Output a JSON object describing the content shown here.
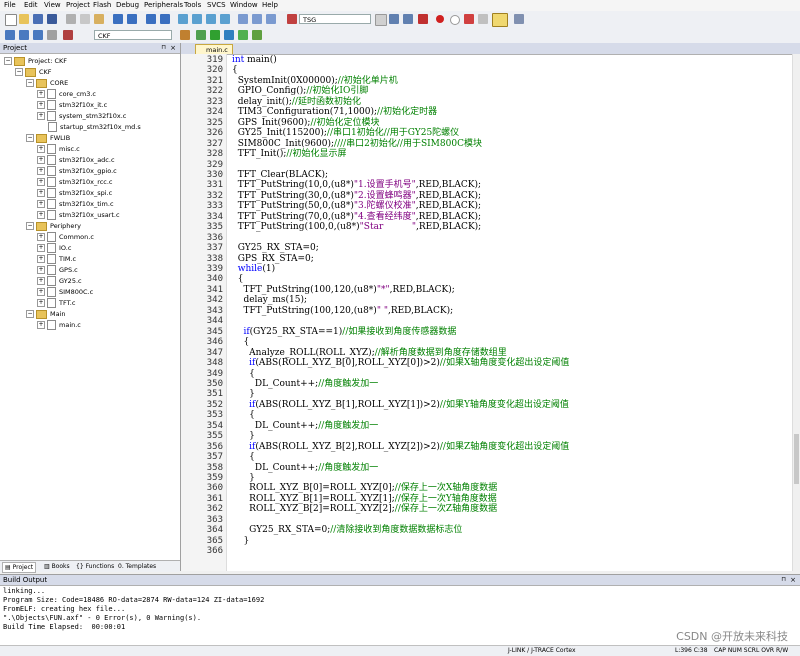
{
  "menu": [
    "File",
    "Edit",
    "View",
    "Project",
    "Flash",
    "Debug",
    "Peripherals",
    "Tools",
    "SVCS",
    "Window",
    "Help"
  ],
  "toolbar": {
    "target_combo": "TSG",
    "project_combo": "CKF"
  },
  "project_pane": {
    "title": "Project",
    "root": "Project: CKF",
    "target": "CKF",
    "groups": [
      {
        "name": "CORE",
        "files": [
          "core_cm3.c",
          "stm32f10x_it.c",
          "system_stm32f10x.c",
          "startup_stm32f10x_md.s"
        ]
      },
      {
        "name": "FWLIB",
        "files": [
          "misc.c",
          "stm32f10x_adc.c",
          "stm32f10x_gpio.c",
          "stm32f10x_rcc.c",
          "stm32f10x_spi.c",
          "stm32f10x_tim.c",
          "stm32f10x_usart.c"
        ]
      },
      {
        "name": "Periphery",
        "files": [
          "Common.c",
          "IO.c",
          "TIM.c",
          "GPS.c",
          "GY25.c",
          "SIM800C.c",
          "TFT.c"
        ]
      },
      {
        "name": "Main",
        "files": [
          "main.c"
        ]
      }
    ],
    "tabs": [
      "Project",
      "Books",
      "Functions",
      "Templates"
    ]
  },
  "editor": {
    "tab": "main.c",
    "lines": [
      {
        "n": "319",
        "t": "int main()"
      },
      {
        "n": "320",
        "t": "{"
      },
      {
        "n": "321",
        "t": "  SystemInit(0X00000);//初始化单片机"
      },
      {
        "n": "322",
        "t": "  GPIO_Config();//初始化IO引脚"
      },
      {
        "n": "323",
        "t": "  delay_init();//延时函数初始化"
      },
      {
        "n": "324",
        "t": "  TIM3_Configuration(71,1000);//初始化定时器"
      },
      {
        "n": "325",
        "t": "  GPS_Init(9600);//初始化定位模块"
      },
      {
        "n": "326",
        "t": "  GY25_Init(115200);//串口1初始化//用于GY25陀螺仪"
      },
      {
        "n": "327",
        "t": "  SIM800C_Init(9600);////串口2初始化//用于SIM800C模块"
      },
      {
        "n": "328",
        "t": "  TFT_Init();//初始化显示屏"
      },
      {
        "n": "329",
        "t": ""
      },
      {
        "n": "330",
        "t": "  TFT_Clear(BLACK);"
      },
      {
        "n": "331",
        "t": "  TFT_PutString(10,0,(u8*)\"1.设置手机号\",RED,BLACK);"
      },
      {
        "n": "332",
        "t": "  TFT_PutString(30,0,(u8*)\"2.设置蜂鸣器\",RED,BLACK);"
      },
      {
        "n": "333",
        "t": "  TFT_PutString(50,0,(u8*)\"3.陀螺仪校准\",RED,BLACK);"
      },
      {
        "n": "334",
        "t": "  TFT_PutString(70,0,(u8*)\"4.查看经纬度\",RED,BLACK);"
      },
      {
        "n": "335",
        "t": "  TFT_PutString(100,0,(u8*)\"Star          \",RED,BLACK);"
      },
      {
        "n": "336",
        "t": ""
      },
      {
        "n": "337",
        "t": "  GY25_RX_STA=0;"
      },
      {
        "n": "338",
        "t": "  GPS_RX_STA=0;"
      },
      {
        "n": "339",
        "t": "  while(1)"
      },
      {
        "n": "340",
        "t": "  {"
      },
      {
        "n": "341",
        "t": "    TFT_PutString(100,120,(u8*)\"*\",RED,BLACK);"
      },
      {
        "n": "342",
        "t": "    delay_ms(15);"
      },
      {
        "n": "343",
        "t": "    TFT_PutString(100,120,(u8*)\" \",RED,BLACK);"
      },
      {
        "n": "344",
        "t": ""
      },
      {
        "n": "345",
        "t": "    if(GY25_RX_STA==1)//如果接收到角度传感器数据"
      },
      {
        "n": "346",
        "t": "    {"
      },
      {
        "n": "347",
        "t": "      Analyze_ROLL(ROLL_XYZ);//解析角度数据到角度存储数组里"
      },
      {
        "n": "348",
        "t": "      if(ABS(ROLL_XYZ_B[0],ROLL_XYZ[0])>2)//如果X轴角度变化超出设定阈值"
      },
      {
        "n": "349",
        "t": "      {"
      },
      {
        "n": "350",
        "t": "        DL_Count++;//角度触发加一"
      },
      {
        "n": "351",
        "t": "      }"
      },
      {
        "n": "352",
        "t": "      if(ABS(ROLL_XYZ_B[1],ROLL_XYZ[1])>2)//如果Y轴角度变化超出设定阈值"
      },
      {
        "n": "353",
        "t": "      {"
      },
      {
        "n": "354",
        "t": "        DL_Count++;//角度触发加一"
      },
      {
        "n": "355",
        "t": "      }"
      },
      {
        "n": "356",
        "t": "      if(ABS(ROLL_XYZ_B[2],ROLL_XYZ[2])>2)//如果Z轴角度变化超出设定阈值"
      },
      {
        "n": "357",
        "t": "      {"
      },
      {
        "n": "358",
        "t": "        DL_Count++;//角度触发加一"
      },
      {
        "n": "359",
        "t": "      }"
      },
      {
        "n": "360",
        "t": "      ROLL_XYZ_B[0]=ROLL_XYZ[0];//保存上一次X轴角度数据"
      },
      {
        "n": "361",
        "t": "      ROLL_XYZ_B[1]=ROLL_XYZ[1];//保存上一次Y轴角度数据"
      },
      {
        "n": "362",
        "t": "      ROLL_XYZ_B[2]=ROLL_XYZ[2];//保存上一次Z轴角度数据"
      },
      {
        "n": "363",
        "t": ""
      },
      {
        "n": "364",
        "t": "      GY25_RX_STA=0;//清除接收到角度数据数据标志位"
      },
      {
        "n": "365",
        "t": "    }"
      },
      {
        "n": "366",
        "t": ""
      }
    ]
  },
  "build_output": {
    "title": "Build Output",
    "lines": [
      "linking...",
      "Program Size: Code=18486 RO-data=2874 RW-data=124 ZI-data=1692",
      "FromELF: creating hex file...",
      "\".\\Objects\\FUN.axf\" - 0 Error(s), 0 Warning(s).",
      "Build Time Elapsed:  00:00:01"
    ]
  },
  "status_bar": {
    "debugger": "J-LINK / J-TRACE Cortex",
    "position": "L:396 C:38",
    "flags": "CAP  NUM  SCRL  OVR  R/W"
  },
  "watermark": "CSDN @开放未来科技",
  "colors": {
    "comment": "#008000",
    "keyword": "#0000ff",
    "string": "#800080",
    "tab_active": "#fff6cc"
  }
}
